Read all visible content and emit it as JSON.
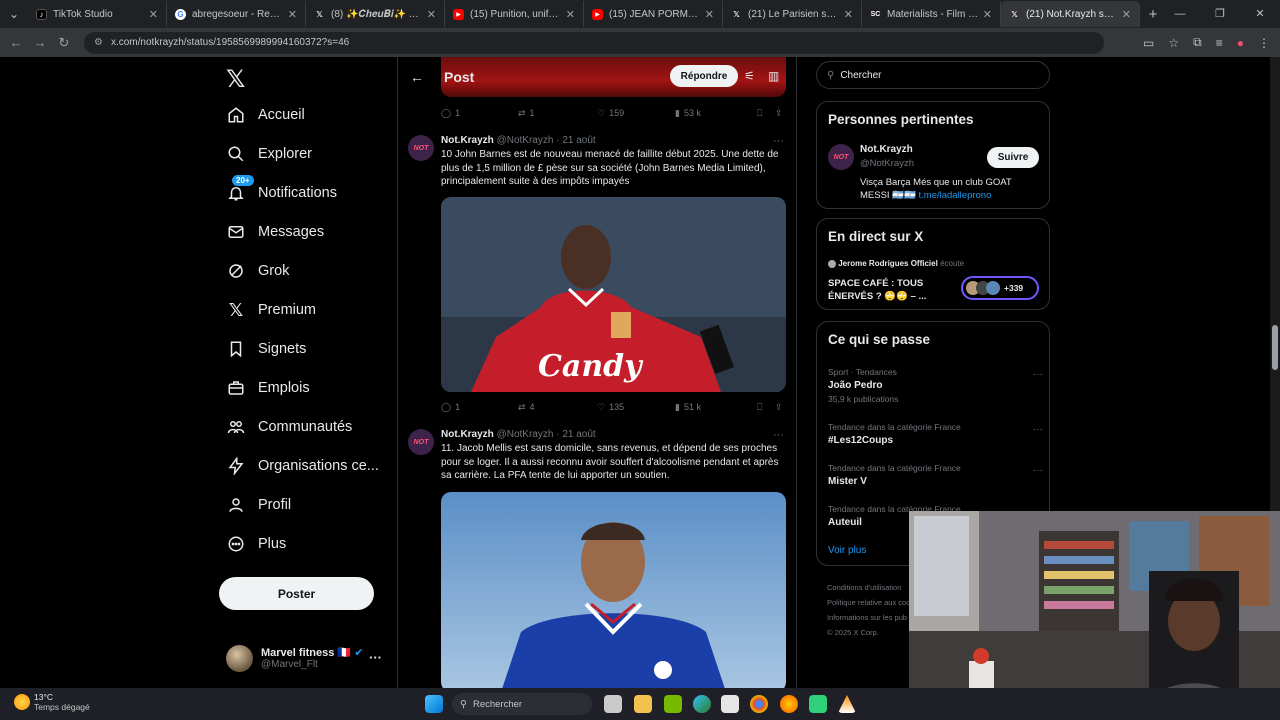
{
  "browser": {
    "tabs": [
      {
        "title": "TikTok Studio",
        "color": "#000000",
        "glyph": "♪"
      },
      {
        "title": "abregesoeur - Recherche",
        "color": "#4285f4",
        "glyph": "G"
      },
      {
        "title": "(8) ✨𝑪𝒉𝒆𝒖𝑩𝒊✨ sur X",
        "color": "#000000",
        "glyph": "X"
      },
      {
        "title": "(15) Punition, uniforme sc",
        "color": "#ff0000",
        "glyph": "▶"
      },
      {
        "title": "(15) JEAN PORMANOVE",
        "color": "#ff0000",
        "glyph": "▶"
      },
      {
        "title": "(21) Le Parisien sur X : \"La",
        "color": "#000000",
        "glyph": "X"
      },
      {
        "title": "Materialists - Film (2025)",
        "color": "#555555",
        "glyph": "SC"
      },
      {
        "title": "(21) Not.Krayzh sur X : \"[",
        "color": "#000000",
        "glyph": "X"
      }
    ],
    "url": "x.com/notkrayzh/status/1958569989994160372?s=46"
  },
  "sidebar": {
    "items": [
      {
        "label": "Accueil",
        "icon": "home-icon"
      },
      {
        "label": "Explorer",
        "icon": "search-icon"
      },
      {
        "label": "Notifications",
        "icon": "bell-icon",
        "badge": "20+"
      },
      {
        "label": "Messages",
        "icon": "envelope-icon"
      },
      {
        "label": "Grok",
        "icon": "grok-icon"
      },
      {
        "label": "Premium",
        "icon": "x-icon"
      },
      {
        "label": "Signets",
        "icon": "bookmark-icon"
      },
      {
        "label": "Emplois",
        "icon": "briefcase-icon"
      },
      {
        "label": "Communautés",
        "icon": "people-icon"
      },
      {
        "label": "Organisations ce...",
        "icon": "bolt-icon"
      },
      {
        "label": "Profil",
        "icon": "person-icon"
      },
      {
        "label": "Plus",
        "icon": "more-circle-icon"
      }
    ],
    "post_label": "Poster",
    "account": {
      "name": "Marvel fitness 🇫🇷",
      "handle": "@Marvel_Flt"
    }
  },
  "feed": {
    "header_title": "Post",
    "reply_label": "Répondre",
    "top_actions": {
      "replies": "1",
      "reposts": "1",
      "likes": "159",
      "views": "53 k"
    },
    "tweets": [
      {
        "name": "Not.Krayzh",
        "handle": "@NotKrayzh",
        "date": "21 août",
        "text": "10 John Barnes est de nouveau menacé de faillite début 2025. Une dette de plus de 1,5 million de £ pèse sur sa société (John Barnes Media Limited), principalement suite à des impôts impayés",
        "jersey_text": "Candy",
        "replies": "1",
        "reposts": "4",
        "likes": "135",
        "views": "51 k"
      },
      {
        "name": "Not.Krayzh",
        "handle": "@NotKrayzh",
        "date": "21 août",
        "text": "11. Jacob Mellis est sans domicile, sans revenus, et dépend de ses proches pour se loger. Il a aussi reconnu avoir souffert d'alcoolisme pendant et après sa carrière. La PFA tente de lui apporter un soutien."
      }
    ]
  },
  "right": {
    "search_placeholder": "Chercher",
    "relevant": {
      "title": "Personnes pertinentes",
      "name": "Not.Krayzh",
      "handle": "@NotKrayzh",
      "follow_label": "Suivre",
      "bio": "Visça Barça Més que un club GOAT MESSI 🇦🇷🇦🇷",
      "link": "t.me/ladalleprono"
    },
    "live": {
      "title": "En direct sur X",
      "host": "Jerome Rodrigues Officiel",
      "host_status": "écoute",
      "space_title": "SPACE CAFÉ : TOUS ÉNERVÉS ? 🙄🙄 – ...",
      "listeners": "+339"
    },
    "trends": {
      "title": "Ce qui se passe",
      "items": [
        {
          "category": "Sport · Tendances",
          "name": "João Pedro",
          "count": "35,9 k publications"
        },
        {
          "category": "Tendance dans la catégorie France",
          "name": "#Les12Coups",
          "count": ""
        },
        {
          "category": "Tendance dans la catégorie France",
          "name": "Mister V",
          "count": ""
        },
        {
          "category": "Tendance dans la catégorie France",
          "name": "Auteuil",
          "count": ""
        }
      ],
      "see_more": "Voir plus"
    },
    "footer": [
      "Conditions d'utilisation",
      "Politique relative aux coo",
      "Informations sur les pub",
      "© 2025 X Corp."
    ]
  },
  "taskbar": {
    "temp": "13°C",
    "weather": "Temps dégagé",
    "search_placeholder": "Rechercher"
  }
}
